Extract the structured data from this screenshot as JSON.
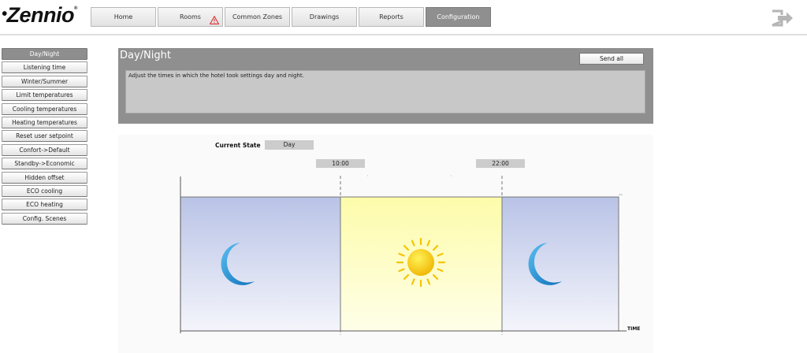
{
  "app": {
    "logo_text": "Zennio",
    "logo_mark": "®"
  },
  "nav": {
    "tabs": [
      {
        "label": "Home"
      },
      {
        "label": "Rooms"
      },
      {
        "label": "Common Zones"
      },
      {
        "label": "Drawings"
      },
      {
        "label": "Reports"
      },
      {
        "label": "Configuration"
      }
    ],
    "active_tab": "Configuration",
    "warning_icon": "warning-triangle-icon",
    "logout_icon": "logout-icon"
  },
  "sidebar": {
    "items": [
      {
        "label": "Day/Night"
      },
      {
        "label": "Listening time"
      },
      {
        "label": "Winter/Summer"
      },
      {
        "label": "Limit temperatures"
      },
      {
        "label": "Cooling temperatures"
      },
      {
        "label": "Heating temperatures"
      },
      {
        "label": "Reset user setpoint"
      },
      {
        "label": "Confort->Default"
      },
      {
        "label": "Standby->Economic"
      },
      {
        "label": "Hidden offset"
      },
      {
        "label": "ECO cooling"
      },
      {
        "label": "ECO heating"
      },
      {
        "label": "Config. Scenes"
      }
    ],
    "active_item": "Day/Night"
  },
  "panel": {
    "title": "Day/Night",
    "send_all_label": "Send all",
    "description": "Adjust the times in which the hotel took settings day and night."
  },
  "schedule": {
    "current_state_label": "Current State",
    "current_state_value": "Day",
    "day_start_time": "10:00",
    "night_start_time": "22:00",
    "axis_label": "TIME",
    "icons": {
      "night": "moon-icon",
      "day": "sun-icon"
    },
    "colors": {
      "night_top": "#b9c3e6",
      "night_bottom": "#f4f5fb",
      "day_top": "#fdfcaa",
      "day_bottom": "#fefee6",
      "sun": "#f6c400",
      "moon": "#1a8fd6"
    }
  }
}
